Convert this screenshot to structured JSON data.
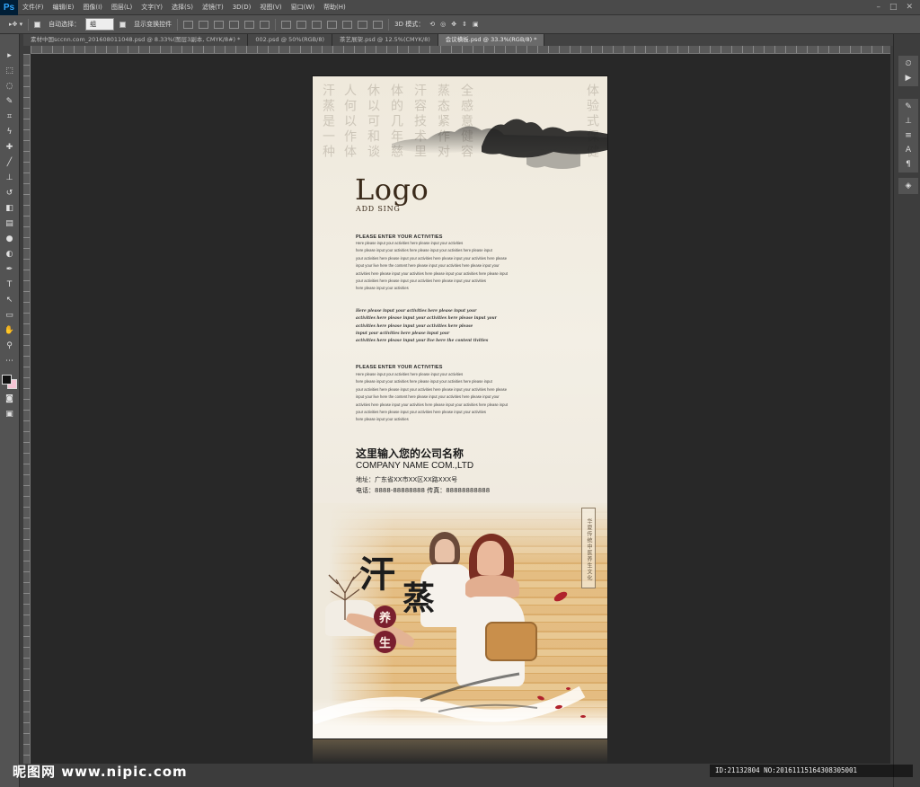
{
  "app": {
    "logo": "Ps",
    "menu": [
      "文件(F)",
      "编辑(E)",
      "图像(I)",
      "图层(L)",
      "文字(Y)",
      "选择(S)",
      "滤镜(T)",
      "3D(D)",
      "视图(V)",
      "窗口(W)",
      "帮助(H)"
    ],
    "window_controls": [
      "–",
      "□",
      "✕"
    ]
  },
  "options": {
    "auto_select_label": "自动选择：",
    "auto_select_value": "组",
    "show_transform_label": "显示变换控件",
    "mode_3d_label": "3D 模式："
  },
  "tabs": [
    "素材中国sccnn.com_201608011048.psd @ 8.33%(图层3副本, CMYK/8#) *",
    "002.psd @ 50%(RGB/8)",
    "茶艺展架.psd @ 12.5%(CMYK/8)",
    "会议横板.psd @ 33.3%(RGB/8) *"
  ],
  "tools": [
    "move-tool",
    "marquee-tool",
    "lasso-tool",
    "quick-select-tool",
    "crop-tool",
    "eyedropper-tool",
    "healing-tool",
    "brush-tool",
    "stamp-tool",
    "history-brush-tool",
    "eraser-tool",
    "gradient-tool",
    "blur-tool",
    "dodge-tool",
    "pen-tool",
    "type-tool",
    "path-select-tool",
    "shape-tool",
    "hand-tool",
    "zoom-tool"
  ],
  "colors": {
    "foreground": "#111111",
    "background": "#f5c4d4",
    "accent_circle": "#7a1f2e"
  },
  "document": {
    "logo": "Logo",
    "logo_sub": "ADD SING",
    "calligraphy_cols": [
      "汗蒸是一种",
      "人何以作体",
      "休以可和谈",
      "体的几年慈",
      "汗容技术里",
      "蒸态紧作对",
      "全感意健容",
      "体验式保健"
    ],
    "section1": {
      "heading": "PLEASE ENTER YOUR ACTIVITIES",
      "lines": [
        "Here please input your activities here please input your activities",
        "here please input your activities here please input your activities here please input",
        "your activities here please input your activities here please input your activities here please",
        "input your live here the content here please input your activities here please input your",
        "activities here please input your activities here please input your activities here please input",
        "your activities here please input your activities here please input your activities",
        "here please input your activities"
      ]
    },
    "section_italic": {
      "lines": [
        "Here please input your activities here please input your",
        "activities here please input your activities here please input your",
        "activities here please input your activities here please",
        "input your activities here please input your",
        "activities here please input your live here the content tivities"
      ]
    },
    "section2": {
      "heading": "PLEASE ENTER YOUR ACTIVITIES",
      "lines": [
        "Here please input your activities here please input your activities",
        "here please input your activities here please input your activities here please input",
        "your activities here please input your activities here please input your activities here please",
        "input your live here the content here please input your activities here please input your",
        "activities here please input your activities here please input your activities here please input",
        "your activities here please input your activities here please input your activities",
        "here please input your activities"
      ]
    },
    "company_cn": "这里输入您的公司名称",
    "company_en": "COMPANY NAME COM.,LTD",
    "address": "地址：广东省XX市XX区XX路XXX号",
    "phone": "电话：8888-88888888   传真：88888888888",
    "big_title": [
      "汗",
      "蒸"
    ],
    "badge": [
      "养",
      "生"
    ],
    "seal_text": "华夏传统中医养生文化"
  },
  "watermark": {
    "left": "昵图网 www.nipic.com",
    "right": "ID:21132804 NO:20161115164308305001"
  }
}
